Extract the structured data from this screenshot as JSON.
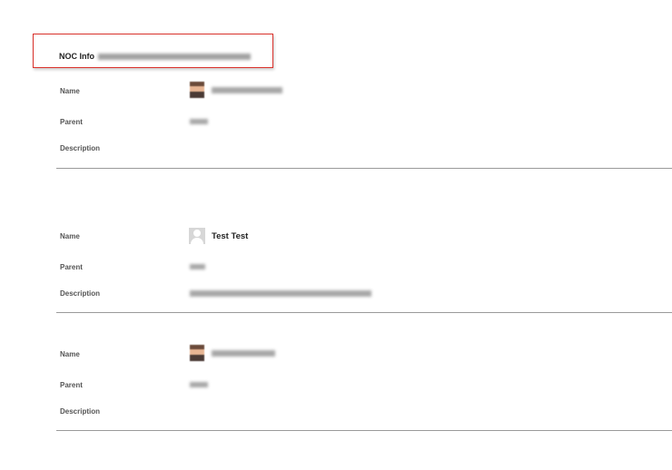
{
  "header": {
    "title": "NOC Info"
  },
  "labels": {
    "name": "Name",
    "parent": "Parent",
    "description": "Description"
  },
  "records": [
    {
      "avatar": "photo-avatar",
      "name": ""
    },
    {
      "avatar": "generic-user-avatar",
      "name": "Test Test"
    },
    {
      "avatar": "photo-avatar",
      "name": ""
    }
  ],
  "colors": {
    "highlight_border": "#d9312b",
    "divider": "#9a9a9a"
  }
}
